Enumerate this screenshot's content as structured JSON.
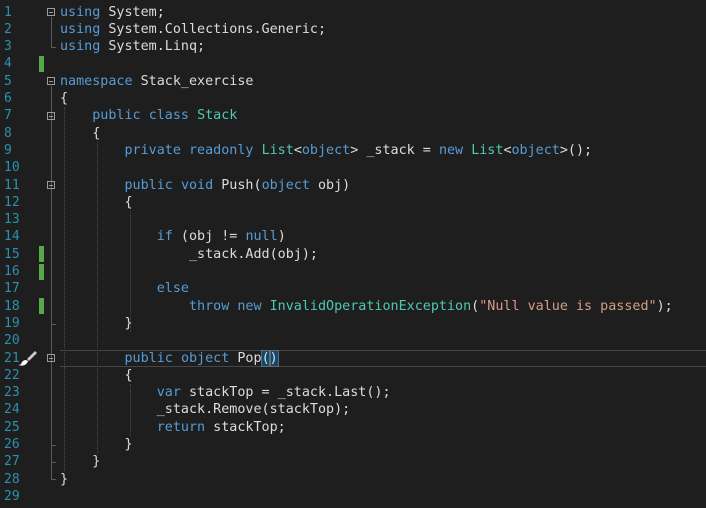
{
  "editor": {
    "language": "csharp",
    "lines": [
      {
        "n": "1",
        "tokens": [
          {
            "t": "kw",
            "v": "using"
          },
          {
            "t": "text",
            "v": " System;"
          }
        ]
      },
      {
        "n": "2",
        "tokens": [
          {
            "t": "kw",
            "v": "using"
          },
          {
            "t": "text",
            "v": " System.Collections.Generic;"
          }
        ]
      },
      {
        "n": "3",
        "tokens": [
          {
            "t": "kw",
            "v": "using"
          },
          {
            "t": "text",
            "v": " System.Linq;"
          }
        ]
      },
      {
        "n": "4",
        "tokens": []
      },
      {
        "n": "5",
        "tokens": [
          {
            "t": "kw",
            "v": "namespace"
          },
          {
            "t": "text",
            "v": " Stack_exercise"
          }
        ]
      },
      {
        "n": "6",
        "tokens": [
          {
            "t": "text",
            "v": "{"
          }
        ]
      },
      {
        "n": "7",
        "tokens": [
          {
            "t": "text",
            "v": "    "
          },
          {
            "t": "kw",
            "v": "public"
          },
          {
            "t": "text",
            "v": " "
          },
          {
            "t": "kw",
            "v": "class"
          },
          {
            "t": "text",
            "v": " "
          },
          {
            "t": "type",
            "v": "Stack"
          }
        ]
      },
      {
        "n": "8",
        "tokens": [
          {
            "t": "text",
            "v": "    {"
          }
        ]
      },
      {
        "n": "9",
        "tokens": [
          {
            "t": "text",
            "v": "        "
          },
          {
            "t": "kw",
            "v": "private"
          },
          {
            "t": "text",
            "v": " "
          },
          {
            "t": "kw",
            "v": "readonly"
          },
          {
            "t": "text",
            "v": " "
          },
          {
            "t": "type",
            "v": "List"
          },
          {
            "t": "text",
            "v": "<"
          },
          {
            "t": "kw",
            "v": "object"
          },
          {
            "t": "text",
            "v": "> _stack = "
          },
          {
            "t": "kw",
            "v": "new"
          },
          {
            "t": "text",
            "v": " "
          },
          {
            "t": "type",
            "v": "List"
          },
          {
            "t": "text",
            "v": "<"
          },
          {
            "t": "kw",
            "v": "object"
          },
          {
            "t": "text",
            "v": ">();"
          }
        ]
      },
      {
        "n": "10",
        "tokens": []
      },
      {
        "n": "11",
        "tokens": [
          {
            "t": "text",
            "v": "        "
          },
          {
            "t": "kw",
            "v": "public"
          },
          {
            "t": "text",
            "v": " "
          },
          {
            "t": "kw",
            "v": "void"
          },
          {
            "t": "text",
            "v": " Push("
          },
          {
            "t": "kw",
            "v": "object"
          },
          {
            "t": "text",
            "v": " obj)"
          }
        ]
      },
      {
        "n": "12",
        "tokens": [
          {
            "t": "text",
            "v": "        {"
          }
        ]
      },
      {
        "n": "13",
        "tokens": []
      },
      {
        "n": "14",
        "tokens": [
          {
            "t": "text",
            "v": "            "
          },
          {
            "t": "kw",
            "v": "if"
          },
          {
            "t": "text",
            "v": " (obj != "
          },
          {
            "t": "kw",
            "v": "null"
          },
          {
            "t": "text",
            "v": ")"
          }
        ]
      },
      {
        "n": "15",
        "tokens": [
          {
            "t": "text",
            "v": "                _stack.Add(obj);"
          }
        ]
      },
      {
        "n": "16",
        "tokens": []
      },
      {
        "n": "17",
        "tokens": [
          {
            "t": "text",
            "v": "            "
          },
          {
            "t": "kw",
            "v": "else"
          }
        ]
      },
      {
        "n": "18",
        "tokens": [
          {
            "t": "text",
            "v": "                "
          },
          {
            "t": "kw",
            "v": "throw"
          },
          {
            "t": "text",
            "v": " "
          },
          {
            "t": "kw",
            "v": "new"
          },
          {
            "t": "text",
            "v": " "
          },
          {
            "t": "type",
            "v": "InvalidOperationException"
          },
          {
            "t": "text",
            "v": "("
          },
          {
            "t": "str",
            "v": "\"Null value is passed\""
          },
          {
            "t": "text",
            "v": ");"
          }
        ]
      },
      {
        "n": "19",
        "tokens": [
          {
            "t": "text",
            "v": "        }"
          }
        ]
      },
      {
        "n": "20",
        "tokens": []
      },
      {
        "n": "21",
        "tokens": [
          {
            "t": "text",
            "v": "        "
          },
          {
            "t": "kw",
            "v": "public"
          },
          {
            "t": "text",
            "v": " "
          },
          {
            "t": "kw",
            "v": "object"
          },
          {
            "t": "text",
            "v": " Pop"
          },
          {
            "t": "brace",
            "v": "("
          },
          {
            "t": "brace",
            "v": ")"
          },
          {
            "t": "caret",
            "v": ""
          }
        ]
      },
      {
        "n": "22",
        "tokens": [
          {
            "t": "text",
            "v": "        {"
          }
        ]
      },
      {
        "n": "23",
        "tokens": [
          {
            "t": "text",
            "v": "            "
          },
          {
            "t": "kw",
            "v": "var"
          },
          {
            "t": "text",
            "v": " stackTop = _stack.Last();"
          }
        ]
      },
      {
        "n": "24",
        "tokens": [
          {
            "t": "text",
            "v": "            _stack.Remove(stackTop);"
          }
        ]
      },
      {
        "n": "25",
        "tokens": [
          {
            "t": "text",
            "v": "            "
          },
          {
            "t": "kw",
            "v": "return"
          },
          {
            "t": "text",
            "v": " stackTop;"
          }
        ]
      },
      {
        "n": "26",
        "tokens": [
          {
            "t": "text",
            "v": "        }"
          }
        ]
      },
      {
        "n": "27",
        "tokens": [
          {
            "t": "text",
            "v": "    }"
          }
        ]
      },
      {
        "n": "28",
        "tokens": [
          {
            "t": "text",
            "v": "}"
          }
        ]
      },
      {
        "n": "29",
        "tokens": []
      }
    ],
    "current_line": "21",
    "changed_lines": [
      "4",
      "15",
      "16",
      "18"
    ],
    "fold_lines": [
      "1",
      "5",
      "7",
      "11",
      "21"
    ],
    "quick_action_icon": "paintbrush-icon",
    "colors": {
      "background": "#1e1e1e",
      "line_number": "#2b91af",
      "keyword": "#569cd6",
      "type": "#4ec9b0",
      "string": "#d69d85",
      "text": "#dcdcdc",
      "change_bar": "#57a64a"
    }
  }
}
